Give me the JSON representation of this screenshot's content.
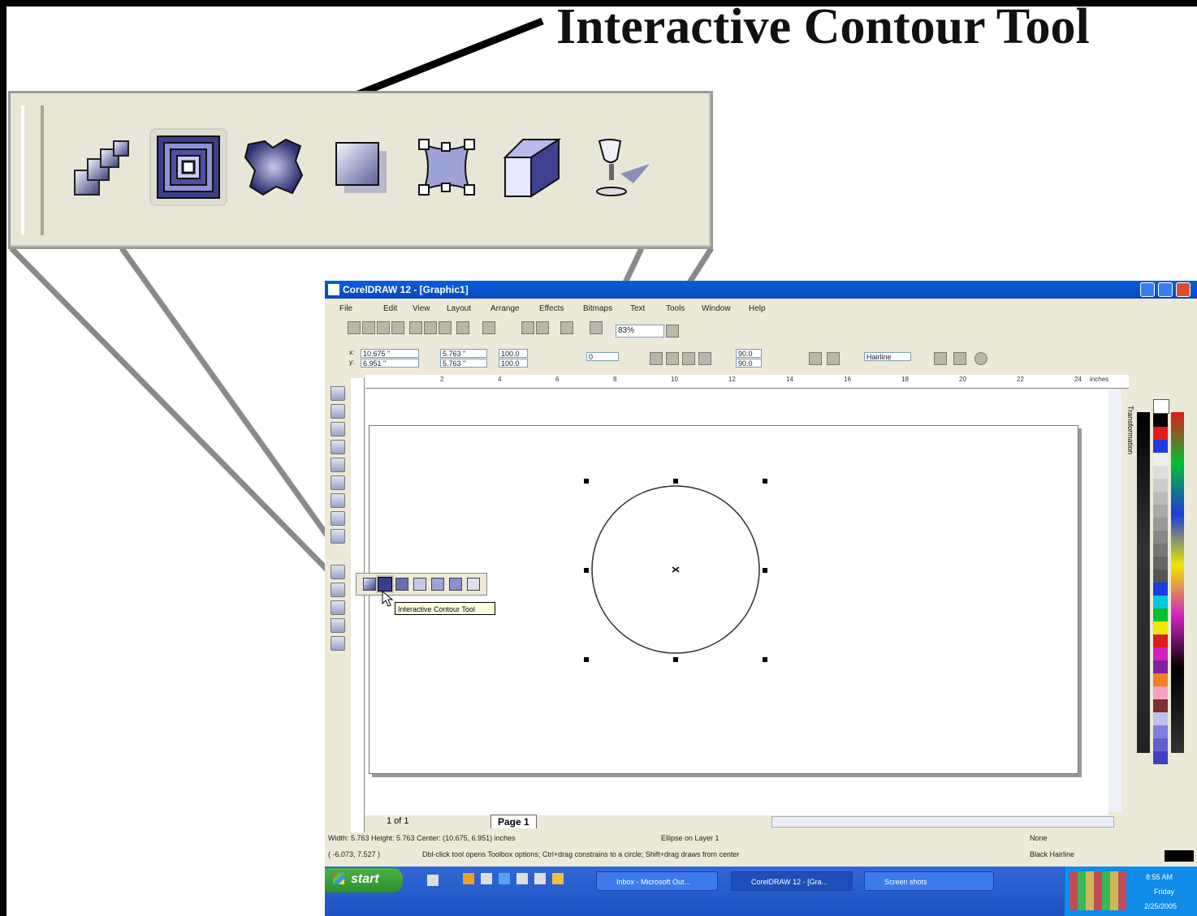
{
  "callout": {
    "title": "Interactive Contour Tool"
  },
  "flyout": {
    "tools": [
      {
        "name": "interactive-blend-tool"
      },
      {
        "name": "interactive-contour-tool",
        "selected": true
      },
      {
        "name": "interactive-distortion-tool"
      },
      {
        "name": "interactive-drop-shadow-tool"
      },
      {
        "name": "interactive-envelope-tool"
      },
      {
        "name": "interactive-extrude-tool"
      },
      {
        "name": "interactive-transparency-tool"
      }
    ]
  },
  "window": {
    "title": "CorelDRAW 12 - [Graphic1]",
    "menu": [
      "File",
      "Edit",
      "View",
      "Layout",
      "Arrange",
      "Effects",
      "Bitmaps",
      "Text",
      "Tools",
      "Window",
      "Help"
    ],
    "zoom": "83%"
  },
  "property_bar": {
    "x": "10.675 \"",
    "y": "6.951 \"",
    "width": "5.763 \"",
    "height": "5.763 \"",
    "scale_w": "100.0",
    "scale_h": "100.0",
    "rotation": "0",
    "start_angle": "90.0",
    "end_angle": "90.0",
    "outline_width": "Hairline"
  },
  "ruler": {
    "ticks": [
      "2",
      "4",
      "6",
      "8",
      "10",
      "12",
      "14",
      "16",
      "18",
      "20",
      "22",
      "24"
    ],
    "units": "inches"
  },
  "docker": {
    "label": "Transformation"
  },
  "pages": {
    "counter": "1 of 1",
    "tab": "Page 1"
  },
  "tooltip": "Interactive Contour Tool",
  "status": {
    "dimensions": "Width: 5.763  Height: 5.763  Center: (10.675, 6.951)  inches",
    "object": "Ellipse on Layer 1",
    "cursor": "( -6.073, 7.527 )",
    "hint": "Dbl-click tool opens Toolbox options; Ctrl+drag constrains to a circle; Shift+drag draws from center",
    "fill": "None",
    "outline": "Black  Hairline"
  },
  "taskbar": {
    "start": "start",
    "tasks": [
      "Inbox - Microsoft Out...",
      "CorelDRAW 12 - [Gra...",
      "Screen shots"
    ],
    "time": "8:55 AM",
    "day": "Friday",
    "date": "2/25/2005"
  },
  "colors": {
    "titlebar": "#0a5fd8",
    "taskbar": "#1e52c2",
    "start_green": "#3aa236",
    "chrome": "#ece9d8"
  }
}
